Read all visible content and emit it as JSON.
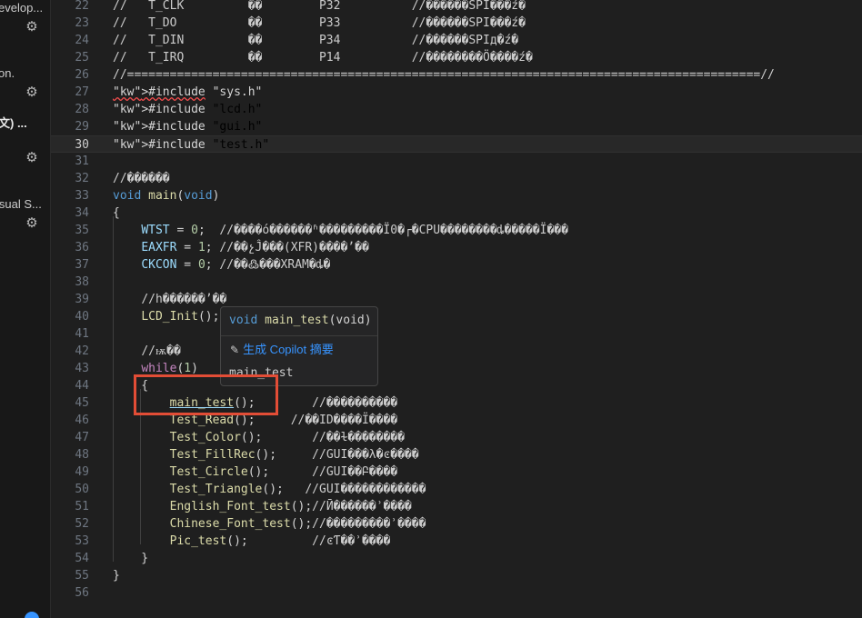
{
  "sidebar": {
    "items": [
      {
        "label": "evelop..."
      },
      {
        "label": "on."
      },
      {
        "label": "文) ..."
      },
      {
        "label": "isual S..."
      }
    ],
    "gear_icon": "gear-icon"
  },
  "editor": {
    "current_line": "30",
    "lines": [
      {
        "n": "22",
        "t": "//   T_CLK         ��        P32          //������SPI���ź�"
      },
      {
        "n": "23",
        "t": "//   T_DO          ��        P33          //������SPI���ź�"
      },
      {
        "n": "24",
        "t": "//   T_DIN         ��        P34          //������SPIд�ź�"
      },
      {
        "n": "25",
        "t": "//   T_IRQ         ��        P14          //��������Ӧ����ź�"
      },
      {
        "n": "26",
        "t": "//=========================================================================================//"
      },
      {
        "n": "27",
        "t": "#include \"sys.h\""
      },
      {
        "n": "28",
        "t": "#include \"lcd.h\""
      },
      {
        "n": "29",
        "t": "#include \"gui.h\""
      },
      {
        "n": "30",
        "t": "#include \"test.h\""
      },
      {
        "n": "31",
        "t": ""
      },
      {
        "n": "32",
        "t": "//������"
      },
      {
        "n": "33",
        "t": "void main(void)"
      },
      {
        "n": "34",
        "t": "{"
      },
      {
        "n": "35",
        "t": "    WTST = 0;  //����ó������ʱ���������Ï0�┌�CPU��������ȡ�����Ï���"
      },
      {
        "n": "36",
        "t": "    EAXFR = 1; //��չĴ���(XFR)����ʼ��"
      },
      {
        "n": "37",
        "t": "    CKCON = 0; //��߷���XRAM�ȡ�"
      },
      {
        "n": "38",
        "t": ""
      },
      {
        "n": "39",
        "t": "    //h������ʼ��"
      },
      {
        "n": "40",
        "t": "    LCD_Init();"
      },
      {
        "n": "41",
        "t": ""
      },
      {
        "n": "42",
        "t": "    //ѭ��"
      },
      {
        "n": "43",
        "t": "    while(1)"
      },
      {
        "n": "44",
        "t": "    {"
      },
      {
        "n": "45",
        "t": "        main_test();        //����������"
      },
      {
        "n": "46",
        "t": "        Test_Read();     //��ID����Ϊ����"
      },
      {
        "n": "47",
        "t": "        Test_Color();       //��ɫ��������"
      },
      {
        "n": "48",
        "t": "        Test_FillRec();     //GUI���λ�ͼ����"
      },
      {
        "n": "49",
        "t": "        Test_Circle();      //GUI��Բ����"
      },
      {
        "n": "50",
        "t": "        Test_Triangle();   //GUI������������"
      },
      {
        "n": "51",
        "t": "        English_Font_test();//Ӣ������ʾ����"
      },
      {
        "n": "52",
        "t": "        Chinese_Font_test();//���������ʾ����"
      },
      {
        "n": "53",
        "t": "        Pic_test();         //ͼƬ��ʾ����"
      },
      {
        "n": "54",
        "t": "    }"
      },
      {
        "n": "55",
        "t": "}"
      },
      {
        "n": "56",
        "t": ""
      }
    ]
  },
  "hover": {
    "signature_type": "void",
    "signature_name": "main_test",
    "signature_params": "(void)",
    "action_label": "生成 Copilot 摘要",
    "tail": "main_test"
  },
  "colors": {
    "accent": "#3794ff",
    "highlight_box": "#e24d36"
  }
}
